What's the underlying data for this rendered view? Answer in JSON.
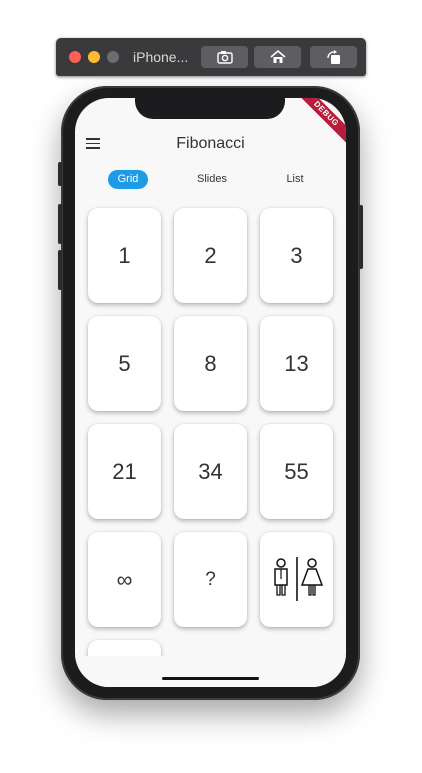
{
  "simulator": {
    "title": "iPhone...",
    "buttons": [
      {
        "icon": "screenshot-icon"
      },
      {
        "icon": "home-icon"
      },
      {
        "icon": "rotate-icon"
      }
    ]
  },
  "app": {
    "title": "Fibonacci",
    "debug_banner": "DEBUG",
    "tabs": [
      {
        "label": "Grid",
        "active": true
      },
      {
        "label": "Slides",
        "active": false
      },
      {
        "label": "List",
        "active": false
      }
    ],
    "cards": [
      {
        "label": "1"
      },
      {
        "label": "2"
      },
      {
        "label": "3"
      },
      {
        "label": "5"
      },
      {
        "label": "8"
      },
      {
        "label": "13"
      },
      {
        "label": "21"
      },
      {
        "label": "34"
      },
      {
        "label": "55"
      },
      {
        "label": "∞"
      },
      {
        "label": "?"
      },
      {
        "label": "",
        "icon": "restroom-icon"
      }
    ]
  },
  "colors": {
    "accent": "#1e9be5",
    "ribbon": "#b71c3a"
  }
}
